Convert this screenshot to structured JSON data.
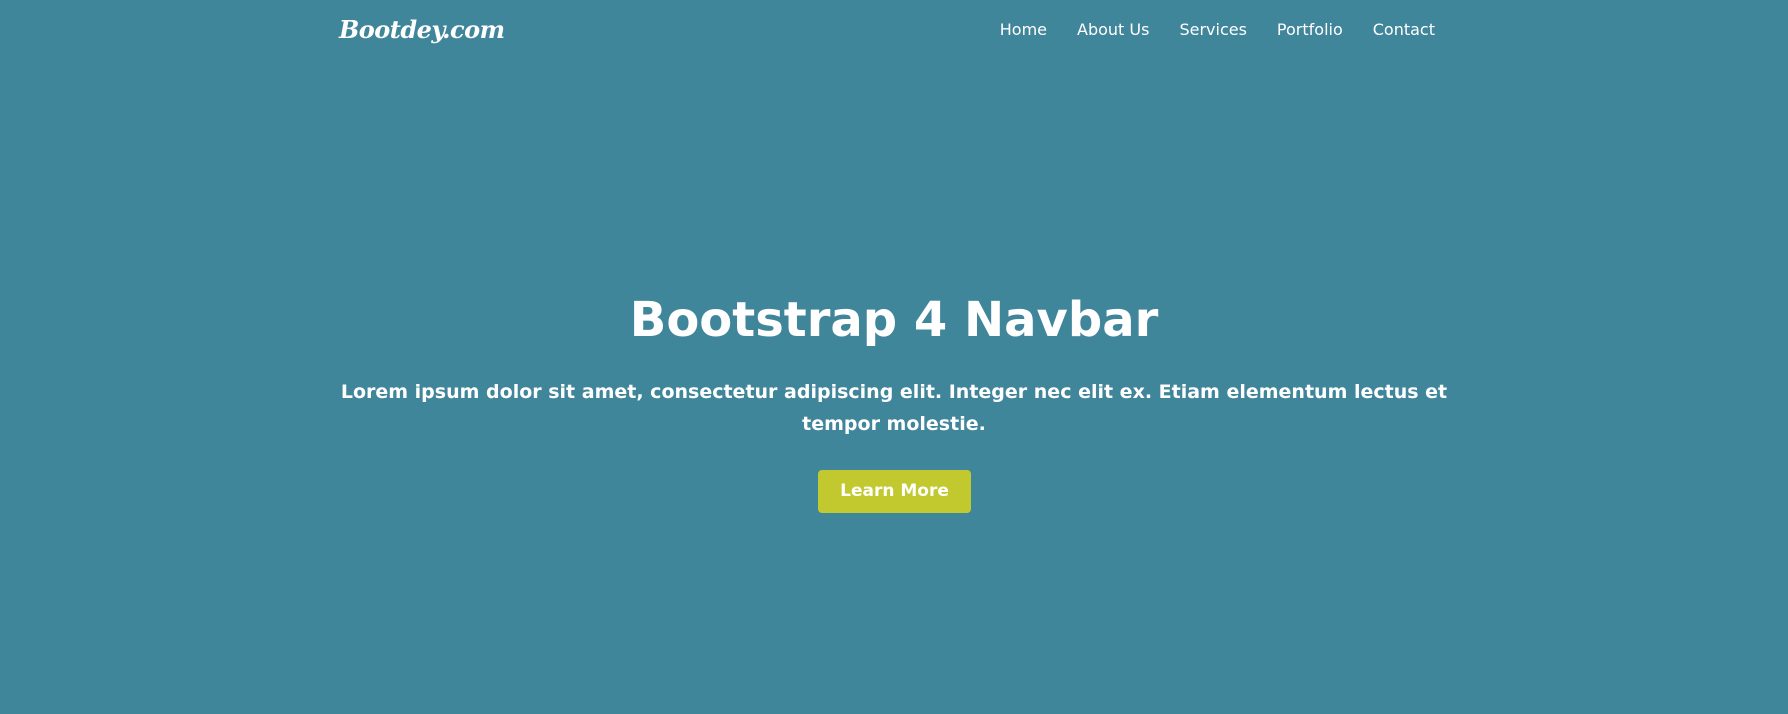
{
  "colors": {
    "background": "#40869b",
    "text": "#ffffff",
    "button_bg": "#c2c92f"
  },
  "navbar": {
    "brand": "Bootdey.com",
    "links": [
      {
        "label": "Home"
      },
      {
        "label": "About Us"
      },
      {
        "label": "Services"
      },
      {
        "label": "Portfolio"
      },
      {
        "label": "Contact"
      }
    ]
  },
  "hero": {
    "title": "Bootstrap 4 Navbar",
    "text": "Lorem ipsum dolor sit amet, consectetur adipiscing elit. Integer nec elit ex. Etiam elementum lectus et tempor molestie.",
    "button_label": "Learn More"
  }
}
